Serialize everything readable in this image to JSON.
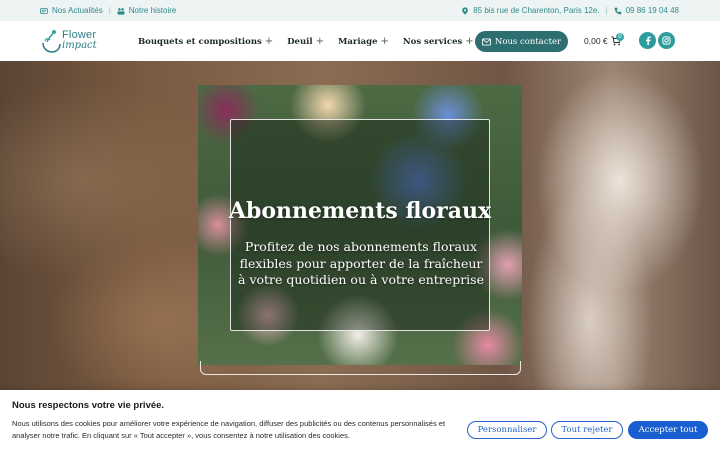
{
  "topbar": {
    "news": "Nos Actualités",
    "story": "Notre histoire",
    "address": "85 bis rue de Charenton, Paris 12e.",
    "phone": "09 86 19 04 48"
  },
  "logo": {
    "line1": "Flower",
    "line2": "impact"
  },
  "nav": [
    {
      "label": "Bouquets et compositions"
    },
    {
      "label": "Deuil"
    },
    {
      "label": "Mariage"
    },
    {
      "label": "Nos services"
    }
  ],
  "contact_label": "Nous contacter",
  "cart": {
    "amount": "0,00 €",
    "count": "0"
  },
  "icons": {
    "news": "newspaper-icon",
    "story": "people-icon",
    "address": "location-pin-icon",
    "phone": "phone-icon",
    "contact": "envelope-icon",
    "cart": "cart-icon",
    "facebook": "facebook-icon",
    "instagram": "instagram-icon"
  },
  "colors": {
    "accent": "#2d6e70",
    "topbar_text": "#2f8a8a",
    "social": "#2d9c9c",
    "cookie_blue": "#1a5fd1"
  },
  "hero": {
    "title": "Abonnements floraux",
    "subtitle": "Profitez de nos abonnements floraux flexibles pour apporter de la fraîcheur à votre quotidien ou à votre entreprise"
  },
  "cookie": {
    "title": "Nous respectons votre vie privée.",
    "text": "Nous utilisons des cookies pour améliorer votre expérience de navigation, diffuser des publicités ou des contenus personnalisés et analyser notre trafic. En cliquant sur « Tout accepter », vous consentez à notre utilisation des cookies.",
    "customize": "Personnaliser",
    "reject": "Tout rejeter",
    "accept": "Accepter tout"
  }
}
